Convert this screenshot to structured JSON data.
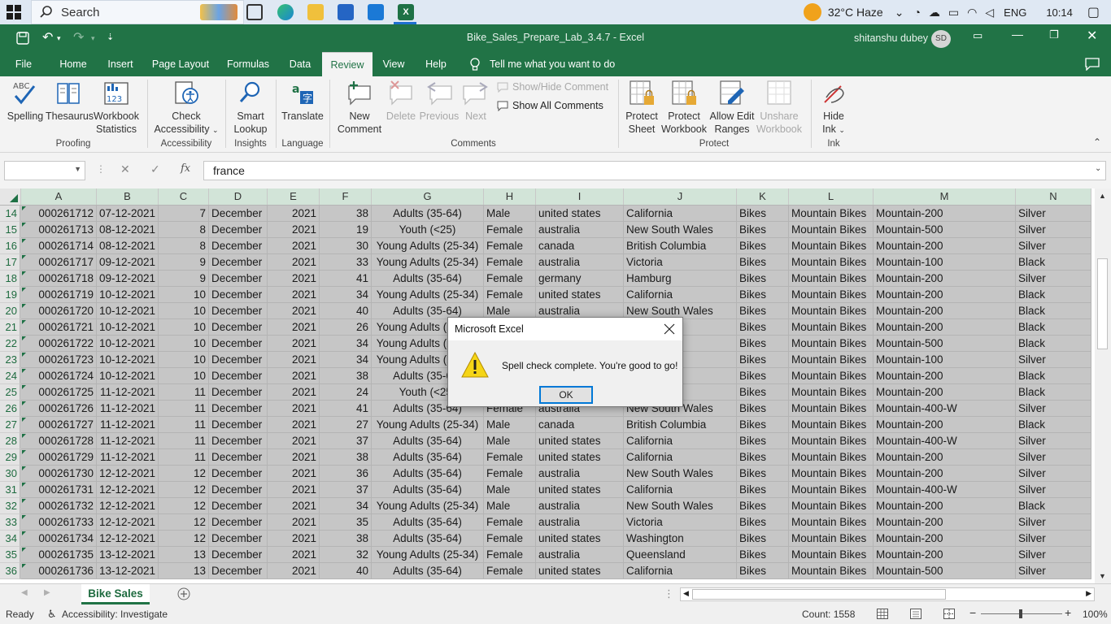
{
  "taskbar": {
    "search_placeholder": "Search",
    "weather": "32°C  Haze",
    "language": "ENG",
    "time": "10:14"
  },
  "titlebar": {
    "title": "Bike_Sales_Prepare_Lab_3.4.7  -  Excel",
    "user": "shitanshu dubey",
    "avatar_initials": "SD"
  },
  "tabs": [
    "File",
    "Home",
    "Insert",
    "Page Layout",
    "Formulas",
    "Data",
    "Review",
    "View",
    "Help"
  ],
  "tell_me": "Tell me what you want to do",
  "ribbon": {
    "spelling": "Spelling",
    "thesaurus": "Thesaurus",
    "workbook_stats_1": "Workbook",
    "workbook_stats_2": "Statistics",
    "proofing": "Proofing",
    "check_acc_1": "Check",
    "check_acc_2": "Accessibility",
    "accessibility": "Accessibility",
    "smart_1": "Smart",
    "smart_2": "Lookup",
    "insights": "Insights",
    "translate": "Translate",
    "language": "Language",
    "new_comment_1": "New",
    "new_comment_2": "Comment",
    "delete": "Delete",
    "previous": "Previous",
    "next": "Next",
    "show_hide": "Show/Hide Comment",
    "show_all": "Show All Comments",
    "comments": "Comments",
    "protect_sheet_1": "Protect",
    "protect_sheet_2": "Sheet",
    "protect_wb_1": "Protect",
    "protect_wb_2": "Workbook",
    "allow_edit_1": "Allow Edit",
    "allow_edit_2": "Ranges",
    "unshare_1": "Unshare",
    "unshare_2": "Workbook",
    "protect": "Protect",
    "hide_ink_1": "Hide",
    "hide_ink_2": "Ink",
    "ink": "Ink"
  },
  "formula_bar": {
    "name_box": "",
    "fx": "fx",
    "value": "france"
  },
  "columns": [
    "A",
    "B",
    "C",
    "D",
    "E",
    "F",
    "G",
    "H",
    "I",
    "J",
    "K",
    "L",
    "M",
    "N"
  ],
  "rows": [
    [
      "14",
      "000261712",
      "07-12-2021",
      "7",
      "December",
      "2021",
      "38",
      "Adults (35-64)",
      "Male",
      "united states",
      "California",
      "Bikes",
      "Mountain Bikes",
      "Mountain-200",
      "Silver"
    ],
    [
      "15",
      "000261713",
      "08-12-2021",
      "8",
      "December",
      "2021",
      "19",
      "Youth (<25)",
      "Female",
      "australia",
      "New South Wales",
      "Bikes",
      "Mountain Bikes",
      "Mountain-500",
      "Silver"
    ],
    [
      "16",
      "000261714",
      "08-12-2021",
      "8",
      "December",
      "2021",
      "30",
      "Young Adults (25-34)",
      "Female",
      "canada",
      "British Columbia",
      "Bikes",
      "Mountain Bikes",
      "Mountain-200",
      "Silver"
    ],
    [
      "17",
      "000261717",
      "09-12-2021",
      "9",
      "December",
      "2021",
      "33",
      "Young Adults (25-34)",
      "Female",
      "australia",
      "Victoria",
      "Bikes",
      "Mountain Bikes",
      "Mountain-100",
      "Black"
    ],
    [
      "18",
      "000261718",
      "09-12-2021",
      "9",
      "December",
      "2021",
      "41",
      "Adults (35-64)",
      "Female",
      "germany",
      "Hamburg",
      "Bikes",
      "Mountain Bikes",
      "Mountain-200",
      "Silver"
    ],
    [
      "19",
      "000261719",
      "10-12-2021",
      "10",
      "December",
      "2021",
      "34",
      "Young Adults (25-34)",
      "Female",
      "united states",
      "California",
      "Bikes",
      "Mountain Bikes",
      "Mountain-200",
      "Black"
    ],
    [
      "20",
      "000261720",
      "10-12-2021",
      "10",
      "December",
      "2021",
      "40",
      "Adults (35-64)",
      "Male",
      "australia",
      "New South Wales",
      "Bikes",
      "Mountain Bikes",
      "Mountain-200",
      "Black"
    ],
    [
      "21",
      "000261721",
      "10-12-2021",
      "10",
      "December",
      "2021",
      "26",
      "Young Adults (25-34)",
      "",
      "",
      "",
      "Bikes",
      "Mountain Bikes",
      "Mountain-200",
      "Black"
    ],
    [
      "22",
      "000261722",
      "10-12-2021",
      "10",
      "December",
      "2021",
      "34",
      "Young Adults (25-34)",
      "",
      "",
      "",
      "Bikes",
      "Mountain Bikes",
      "Mountain-500",
      "Black"
    ],
    [
      "23",
      "000261723",
      "10-12-2021",
      "10",
      "December",
      "2021",
      "34",
      "Young Adults (25-34)",
      "",
      "",
      "",
      "Bikes",
      "Mountain Bikes",
      "Mountain-100",
      "Silver"
    ],
    [
      "24",
      "000261724",
      "10-12-2021",
      "10",
      "December",
      "2021",
      "38",
      "Adults (35-64)",
      "",
      "",
      "",
      "Bikes",
      "Mountain Bikes",
      "Mountain-200",
      "Black"
    ],
    [
      "25",
      "000261725",
      "11-12-2021",
      "11",
      "December",
      "2021",
      "24",
      "Youth (<25)",
      "",
      "",
      "",
      "Bikes",
      "Mountain Bikes",
      "Mountain-200",
      "Black"
    ],
    [
      "26",
      "000261726",
      "11-12-2021",
      "11",
      "December",
      "2021",
      "41",
      "Adults (35-64)",
      "Female",
      "australia",
      "New South Wales",
      "Bikes",
      "Mountain Bikes",
      "Mountain-400-W",
      "Silver"
    ],
    [
      "27",
      "000261727",
      "11-12-2021",
      "11",
      "December",
      "2021",
      "27",
      "Young Adults (25-34)",
      "Male",
      "canada",
      "British Columbia",
      "Bikes",
      "Mountain Bikes",
      "Mountain-200",
      "Black"
    ],
    [
      "28",
      "000261728",
      "11-12-2021",
      "11",
      "December",
      "2021",
      "37",
      "Adults (35-64)",
      "Male",
      "united states",
      "California",
      "Bikes",
      "Mountain Bikes",
      "Mountain-400-W",
      "Silver"
    ],
    [
      "29",
      "000261729",
      "11-12-2021",
      "11",
      "December",
      "2021",
      "38",
      "Adults (35-64)",
      "Female",
      "united states",
      "California",
      "Bikes",
      "Mountain Bikes",
      "Mountain-200",
      "Silver"
    ],
    [
      "30",
      "000261730",
      "12-12-2021",
      "12",
      "December",
      "2021",
      "36",
      "Adults (35-64)",
      "Female",
      "australia",
      "New South Wales",
      "Bikes",
      "Mountain Bikes",
      "Mountain-200",
      "Silver"
    ],
    [
      "31",
      "000261731",
      "12-12-2021",
      "12",
      "December",
      "2021",
      "37",
      "Adults (35-64)",
      "Male",
      "united states",
      "California",
      "Bikes",
      "Mountain Bikes",
      "Mountain-400-W",
      "Silver"
    ],
    [
      "32",
      "000261732",
      "12-12-2021",
      "12",
      "December",
      "2021",
      "34",
      "Young Adults (25-34)",
      "Male",
      "australia",
      "New South Wales",
      "Bikes",
      "Mountain Bikes",
      "Mountain-200",
      "Black"
    ],
    [
      "33",
      "000261733",
      "12-12-2021",
      "12",
      "December",
      "2021",
      "35",
      "Adults (35-64)",
      "Female",
      "australia",
      "Victoria",
      "Bikes",
      "Mountain Bikes",
      "Mountain-200",
      "Silver"
    ],
    [
      "34",
      "000261734",
      "12-12-2021",
      "12",
      "December",
      "2021",
      "38",
      "Adults (35-64)",
      "Female",
      "united states",
      "Washington",
      "Bikes",
      "Mountain Bikes",
      "Mountain-200",
      "Silver"
    ],
    [
      "35",
      "000261735",
      "13-12-2021",
      "13",
      "December",
      "2021",
      "32",
      "Young Adults (25-34)",
      "Female",
      "australia",
      "Queensland",
      "Bikes",
      "Mountain Bikes",
      "Mountain-200",
      "Silver"
    ],
    [
      "36",
      "000261736",
      "13-12-2021",
      "13",
      "December",
      "2021",
      "40",
      "Adults (35-64)",
      "Female",
      "united states",
      "California",
      "Bikes",
      "Mountain Bikes",
      "Mountain-500",
      "Silver"
    ]
  ],
  "sheet_tab": "Bike Sales",
  "status": {
    "ready": "Ready",
    "accessibility": "Accessibility: Investigate",
    "count": "Count: 1558",
    "zoom": "100%"
  },
  "dialog": {
    "title": "Microsoft Excel",
    "message": "Spell check complete. You're good to go!",
    "ok": "OK"
  },
  "colors": {
    "excel_green": "#217346",
    "selection": "#c6c6c6",
    "dialog_border": "#0078d7"
  }
}
